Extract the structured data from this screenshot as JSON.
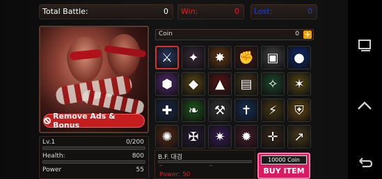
{
  "header": {
    "total_battle": {
      "label": "Total Battle:",
      "value": "0"
    },
    "win": {
      "label": "Win:",
      "value": "0"
    },
    "lost": {
      "label": "Lost:",
      "value": "0"
    }
  },
  "hero": {
    "remove_ads_label": "Remove Ads & Bonus"
  },
  "stats": [
    {
      "label": "Lv.1",
      "value": "0/200"
    },
    {
      "label": "Health:",
      "value": "800"
    },
    {
      "label": "Power",
      "value": "55"
    }
  ],
  "shop": {
    "coin_label": "Coin",
    "coin_value": "0",
    "coin_add": "+",
    "items": [
      {
        "icon": "sword-icon",
        "bg": "#2a3a6a",
        "glyph": "⚔"
      },
      {
        "icon": "claw-icon",
        "bg": "#3a2a3a",
        "glyph": "✦"
      },
      {
        "icon": "wings-icon",
        "bg": "#6a3a12",
        "glyph": "✸"
      },
      {
        "icon": "gauntlet-icon",
        "bg": "#4a1a14",
        "glyph": "✊"
      },
      {
        "icon": "chest-icon",
        "bg": "#4a4a4a",
        "glyph": "▣"
      },
      {
        "icon": "orb-icon",
        "bg": "#0c2a7a",
        "glyph": "●"
      },
      {
        "icon": "boot-icon",
        "bg": "#5a2a7a",
        "glyph": "⬢"
      },
      {
        "icon": "gold-armor-icon",
        "bg": "#5a4a12",
        "glyph": "◆"
      },
      {
        "icon": "red-helm-icon",
        "bg": "#5a1414",
        "glyph": "▲"
      },
      {
        "icon": "tome-icon",
        "bg": "#4a3a1a",
        "glyph": "▤"
      },
      {
        "icon": "green-blade-icon",
        "bg": "#1a4a2a",
        "glyph": "✧"
      },
      {
        "icon": "gold-blade-icon",
        "bg": "#5a4a14",
        "glyph": "✶"
      },
      {
        "icon": "scepter-icon",
        "bg": "#1a2a4a",
        "glyph": "✚"
      },
      {
        "icon": "leaf-blade-icon",
        "bg": "#1a5a1a",
        "glyph": "❧"
      },
      {
        "icon": "axe-icon",
        "bg": "#3a3a3a",
        "glyph": "⚒"
      },
      {
        "icon": "blue-sword-icon",
        "bg": "#14305a",
        "glyph": "✝"
      },
      {
        "icon": "double-blade-icon",
        "bg": "#4a3a14",
        "glyph": "⚡"
      },
      {
        "icon": "shield-icon",
        "bg": "#6a4a12",
        "glyph": "⛨"
      },
      {
        "icon": "fire-claw-icon",
        "bg": "#5a2a14",
        "glyph": "✺"
      },
      {
        "icon": "dark-blade-icon",
        "bg": "#2a1a3a",
        "glyph": "✠"
      },
      {
        "icon": "purple-axe-icon",
        "bg": "#3a1a5a",
        "glyph": "✷"
      },
      {
        "icon": "spike-icon",
        "bg": "#4a1a2a",
        "glyph": "✹"
      },
      {
        "icon": "cross-blade-icon",
        "bg": "#3a2a1a",
        "glyph": "✛"
      },
      {
        "icon": "spear-icon",
        "bg": "#4a3a1a",
        "glyph": "↗"
      }
    ],
    "selected_item": {
      "name": "B.F. 대검",
      "dash1": "–",
      "dash2": "–",
      "power": "Power: 50"
    },
    "price": "10000 Coin",
    "buy_label": "BUY ITEM"
  },
  "navbar": {
    "home": "home-icon",
    "recents": "recents-icon",
    "back": "back-icon"
  }
}
